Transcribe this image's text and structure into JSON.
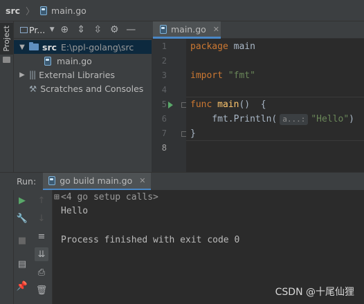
{
  "breadcrumb": {
    "root": "src",
    "file": "main.go"
  },
  "sidebar": {
    "project_tab": "Project"
  },
  "project": {
    "title": "Pr...",
    "tree": [
      {
        "name": "src",
        "path": "E:\\ppl-golang\\src",
        "selected": true
      },
      {
        "name": "main.go"
      },
      {
        "name": "External Libraries"
      },
      {
        "name": "Scratches and Consoles"
      }
    ]
  },
  "editor": {
    "tab": "main.go",
    "line_numbers": [
      "1",
      "2",
      "3",
      "4",
      "5",
      "6",
      "7",
      "8"
    ],
    "lines": {
      "l1_kw": "package",
      "l1_rest": " main",
      "l3_kw": "import",
      "l3_str": "\"fmt\"",
      "l5_kw": "func",
      "l5_fn": " main",
      "l5_rest": "()  {",
      "l6_pre": "    fmt.Println(",
      "l6_hint": "a...:",
      "l6_str": "\"Hello\"",
      "l6_post": ")",
      "l7": "}"
    }
  },
  "run": {
    "label": "Run:",
    "tab": "go build main.go",
    "console": [
      "<4 go setup calls>",
      "Hello",
      "",
      "Process finished with exit code 0"
    ]
  },
  "watermark": "CSDN @十尾仙狸",
  "colors": {
    "keyword": "#cc7832",
    "string": "#6a8759",
    "function": "#ffc66d",
    "selection": "#0d293e",
    "accent": "#4a88c7",
    "run_green": "#59a869"
  }
}
